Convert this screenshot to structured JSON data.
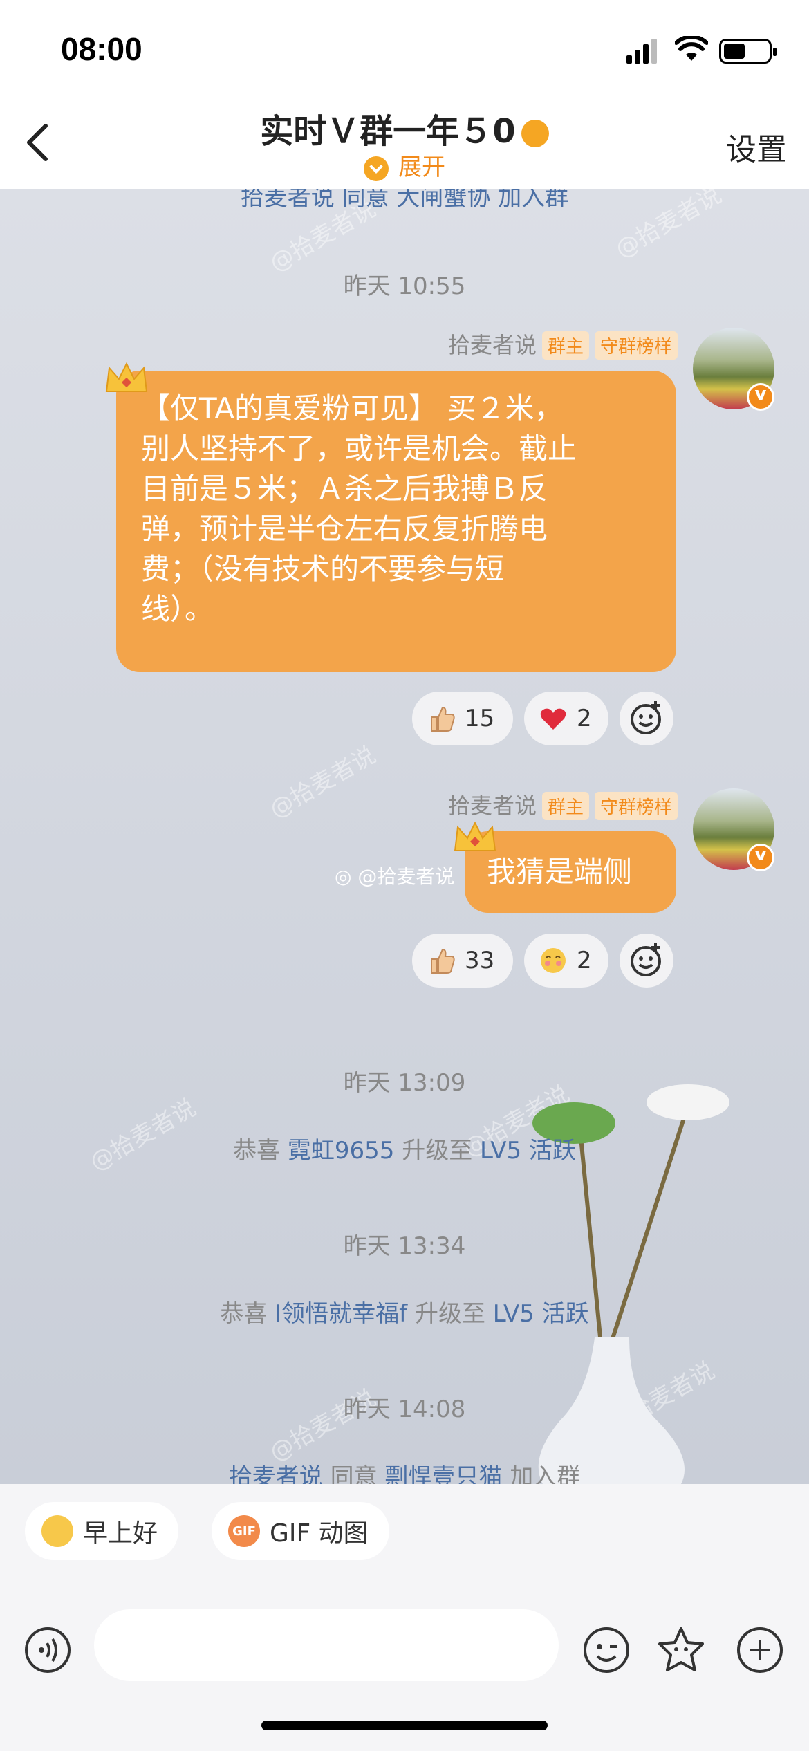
{
  "status_bar": {
    "time": "08:00"
  },
  "nav": {
    "title": "实时Ｖ群一年５0",
    "expand_label": "展开",
    "settings_label": "设置"
  },
  "chat": {
    "partial_top_text": "拾麦者说 同意 大闸蟹协 加入群",
    "watermark": "@拾麦者说",
    "messages": [
      {
        "time": "昨天 10:55",
        "sender": "拾麦者说",
        "tags": [
          "群主",
          "守群榜样"
        ],
        "lines": [
          "【仅TA的真爱粉可见】 买２米，",
          "别人坚持不了，或许是机会。截止",
          "目前是５米；Ａ杀之后我搏Ｂ反",
          "弹，预计是半仓左右反复折腾电",
          "费；（没有技术的不要参与短",
          "线）。"
        ],
        "reactions": [
          {
            "emoji": "thumbs-up",
            "count": "15"
          },
          {
            "emoji": "heart",
            "count": "2"
          }
        ]
      },
      {
        "sender": "拾麦者说",
        "tags": [
          "群主",
          "守群榜样"
        ],
        "text": "我猜是端侧",
        "weibo_watermark": "@拾麦者说",
        "reactions": [
          {
            "emoji": "thumbs-up",
            "count": "33"
          },
          {
            "emoji": "shy-face",
            "count": "2"
          }
        ]
      }
    ],
    "system_events": [
      {
        "time": "昨天 13:09",
        "prefix": "恭喜",
        "user": "霓虹9655",
        "middle": "升级至",
        "level": "LV5 活跃"
      },
      {
        "time": "昨天 13:34",
        "prefix": "恭喜",
        "user": "I领悟就幸福f",
        "middle": "升级至",
        "level": "LV5 活跃"
      },
      {
        "time": "昨天 14:08",
        "prefix": "",
        "user": "拾麦者说",
        "middle": "同意",
        "level": "剽悍壹只猫",
        "suffix": "加入群"
      }
    ]
  },
  "quick_replies": [
    {
      "label": "早上好",
      "icon": "sun-face-icon"
    },
    {
      "label": "GIF 动图",
      "icon": "gif-icon",
      "icon_text": "GIF"
    }
  ],
  "input": {
    "placeholder": ""
  },
  "colors": {
    "accent": "#f3a44a",
    "link": "#4a6fa5",
    "tag_bg": "#fbe3c4"
  }
}
